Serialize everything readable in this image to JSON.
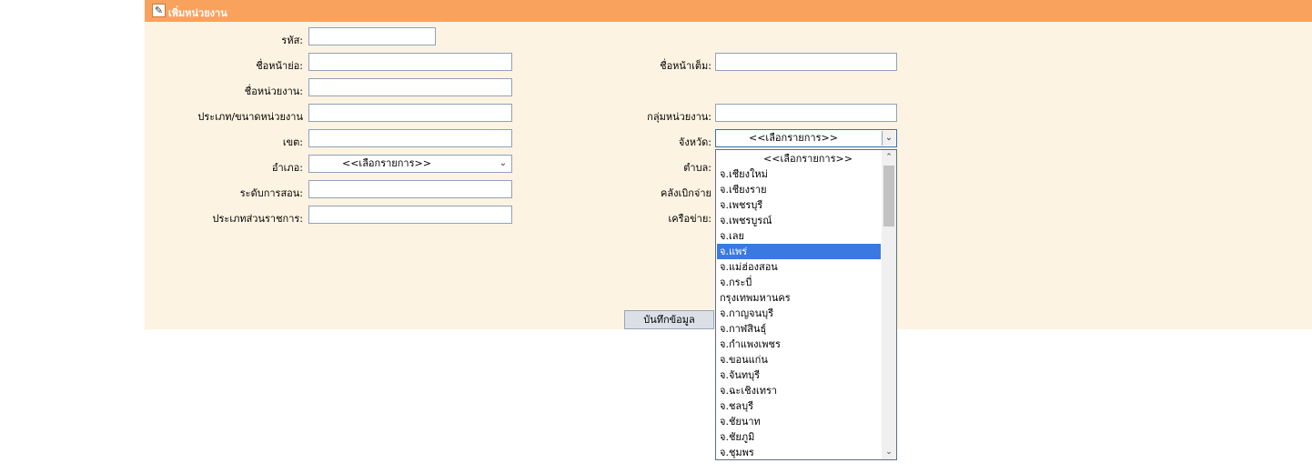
{
  "title": "เพิ่มหน่วยงาน",
  "form": {
    "code_label": "รหัส:",
    "prefix_short_label": "ชื่อหน้าย่อ:",
    "prefix_full_label": "ชื่อหน้าเต็ม:",
    "unit_name_label": "ชื่อหน่วยงาน:",
    "unit_type_label": "ประเภท/ขนาดหน่วยงาน",
    "unit_group_label": "กลุ่มหน่วยงาน:",
    "zone_label": "เขต:",
    "province_label": "จังหวัด:",
    "district_label": "อำเภอ:",
    "subdistrict_label": "ตำบล:",
    "teaching_level_label": "ระดับการสอน:",
    "treasury_label": "คลังเบิกจ่าย",
    "gov_type_label": "ประเภทส่วนราชการ:",
    "network_label": "เครือข่าย:",
    "district_value": "<<เลือกรายการ>>",
    "province_value": "<<เลือกรายการ>>",
    "save_button": "บันทึกข้อมูล"
  },
  "province_options": [
    "<<เลือกรายการ>>",
    "จ.เชียงใหม่",
    "จ.เชียงราย",
    "จ.เพชรบุรี",
    "จ.เพชรบูรณ์",
    "จ.เลย",
    "จ.แพร่",
    "จ.แม่ฮ่องสอน",
    "จ.กระบี่",
    "กรุงเทพมหานคร",
    "จ.กาญจนบุรี",
    "จ.กาฬสินธุ์",
    "จ.กำแพงเพชร",
    "จ.ขอนแก่น",
    "จ.จันทบุรี",
    "จ.ฉะเชิงเทรา",
    "จ.ชลบุรี",
    "จ.ชัยนาท",
    "จ.ชัยภูมิ",
    "จ.ชุมพร"
  ],
  "selected_option_index": 6,
  "icons": {
    "title": "pencil-edit-icon",
    "dropdown_arrow": "chevron-down-icon",
    "scroll_up": "chevron-up-icon",
    "scroll_down": "chevron-down-icon"
  },
  "colors": {
    "titlebar": "#f9a25e",
    "panel": "#fdf3e2",
    "selection": "#3a7ae0"
  }
}
